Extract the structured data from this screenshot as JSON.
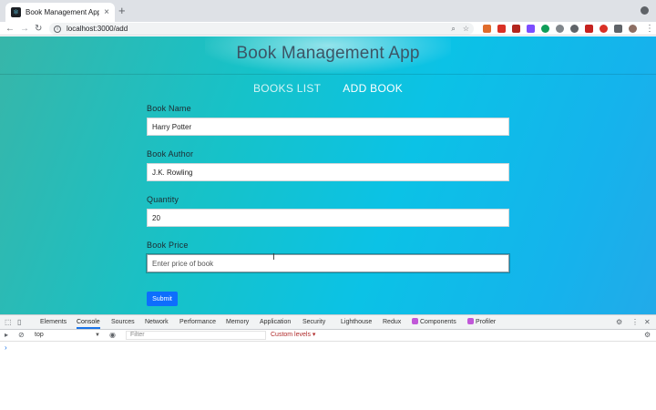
{
  "browser": {
    "tab_title": "Book Management App",
    "tab_close": "×",
    "new_tab": "+",
    "url": "localhost:3000/add",
    "back": "←",
    "forward": "→",
    "reload": "↻"
  },
  "app": {
    "title": "Book Management App",
    "nav": [
      {
        "label": "BOOKS LIST",
        "active": false
      },
      {
        "label": "ADD BOOK",
        "active": true
      }
    ],
    "form": {
      "book_name": {
        "label": "Book Name",
        "value": "Harry Potter"
      },
      "book_author": {
        "label": "Book Author",
        "value": "J.K. Rowling"
      },
      "quantity": {
        "label": "Quantity",
        "value": "20"
      },
      "book_price": {
        "label": "Book Price",
        "value": "",
        "placeholder": "Enter price of book"
      },
      "submit_label": "Submit"
    }
  },
  "devtools": {
    "tabs": [
      "Elements",
      "Console",
      "Sources",
      "Network",
      "Performance",
      "Memory",
      "Application",
      "Security",
      "Lighthouse",
      "Redux",
      "Components",
      "Profiler"
    ],
    "active_tab": "Console",
    "context": "top",
    "filter_placeholder": "Filter",
    "levels": "Custom levels",
    "prompt": "›"
  },
  "colors": {
    "accent": "#1a73e8",
    "submit": "#0d6efd",
    "react_badge": "#c058d8"
  }
}
